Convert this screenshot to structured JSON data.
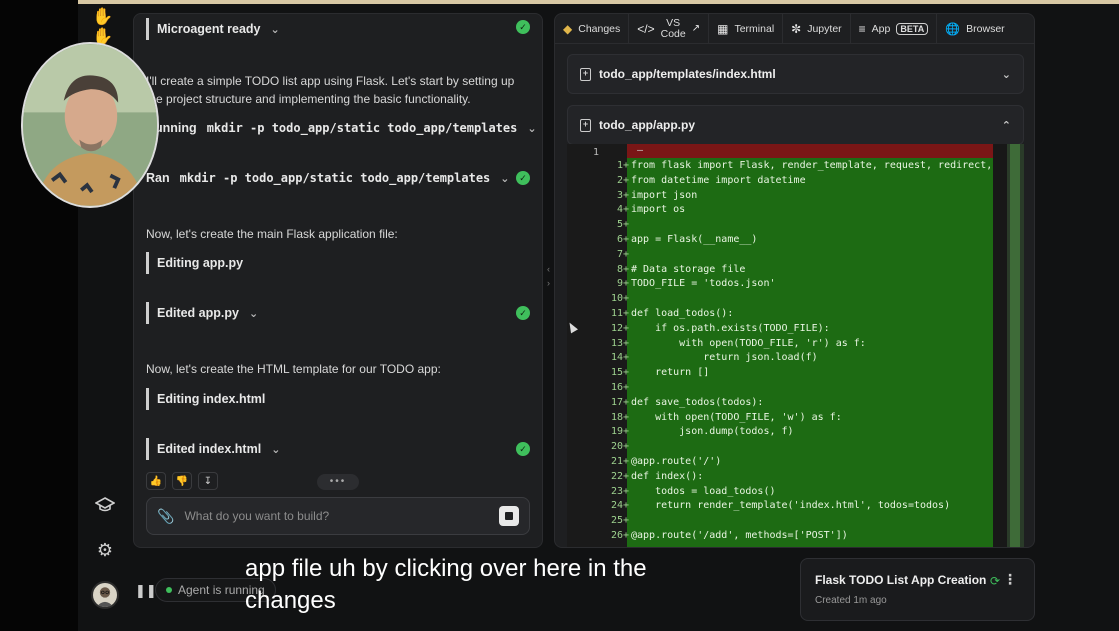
{
  "rail": {
    "logo_icon": "hands-icon",
    "items": [
      "graduation-cap-icon",
      "gear-icon"
    ]
  },
  "chat": {
    "microagent": "Microagent ready",
    "intro": "I'll create a simple TODO list app using Flask. Let's start by setting up the project structure and implementing the basic functionality.",
    "running_prefix": "Running",
    "ran_prefix": "Ran",
    "cmd": "mkdir -p todo_app/static todo_app/templates",
    "para1": "Now, let's create the main Flask application file:",
    "editing1": "Editing app.py",
    "edited1": "Edited app.py",
    "para2": "Now, let's create the HTML template for our TODO app:",
    "editing2": "Editing index.html",
    "edited2": "Edited index.html",
    "more": "•••",
    "placeholder": "What do you want to build?"
  },
  "tabs": {
    "changes": "Changes",
    "vscode_1": "VS",
    "vscode_2": "Code",
    "terminal": "Terminal",
    "jupyter": "Jupyter",
    "app": "App",
    "beta": "BETA",
    "browser": "Browser"
  },
  "files": {
    "f1": "todo_app/templates/index.html",
    "f2": "todo_app/app.py"
  },
  "code": {
    "old_line_no": "1",
    "old_line": "—",
    "lines": [
      {
        "n": "1+",
        "t": "from flask import Flask, render_template, request, redirect,"
      },
      {
        "n": "2+",
        "t": "from datetime import datetime"
      },
      {
        "n": "3+",
        "t": "import json"
      },
      {
        "n": "4+",
        "t": "import os"
      },
      {
        "n": "5+",
        "t": ""
      },
      {
        "n": "6+",
        "t": "app = Flask(__name__)"
      },
      {
        "n": "7+",
        "t": ""
      },
      {
        "n": "8+",
        "t": "# Data storage file"
      },
      {
        "n": "9+",
        "t": "TODO_FILE = 'todos.json'"
      },
      {
        "n": "10+",
        "t": ""
      },
      {
        "n": "11+",
        "t": "def load_todos():"
      },
      {
        "n": "12+",
        "t": "    if os.path.exists(TODO_FILE):"
      },
      {
        "n": "13+",
        "t": "        with open(TODO_FILE, 'r') as f:"
      },
      {
        "n": "14+",
        "t": "            return json.load(f)"
      },
      {
        "n": "15+",
        "t": "    return []"
      },
      {
        "n": "16+",
        "t": ""
      },
      {
        "n": "17+",
        "t": "def save_todos(todos):"
      },
      {
        "n": "18+",
        "t": "    with open(TODO_FILE, 'w') as f:"
      },
      {
        "n": "19+",
        "t": "        json.dump(todos, f)"
      },
      {
        "n": "20+",
        "t": ""
      },
      {
        "n": "21+",
        "t": "@app.route('/')"
      },
      {
        "n": "22+",
        "t": "def index():"
      },
      {
        "n": "23+",
        "t": "    todos = load_todos()"
      },
      {
        "n": "24+",
        "t": "    return render_template('index.html', todos=todos)"
      },
      {
        "n": "25+",
        "t": ""
      },
      {
        "n": "26+",
        "t": "@app.route('/add', methods=['POST'])"
      }
    ]
  },
  "bottom": {
    "status": "Agent is running",
    "caption_1": "app file uh by clicking over here in the",
    "caption_2": "changes",
    "conv_title": "Flask TODO List App Creation",
    "conv_time": "Created 1m ago"
  },
  "colors": {
    "added_bg": "#1d6b13",
    "removed_bg": "#7a1616",
    "check": "#3fbf5c"
  }
}
